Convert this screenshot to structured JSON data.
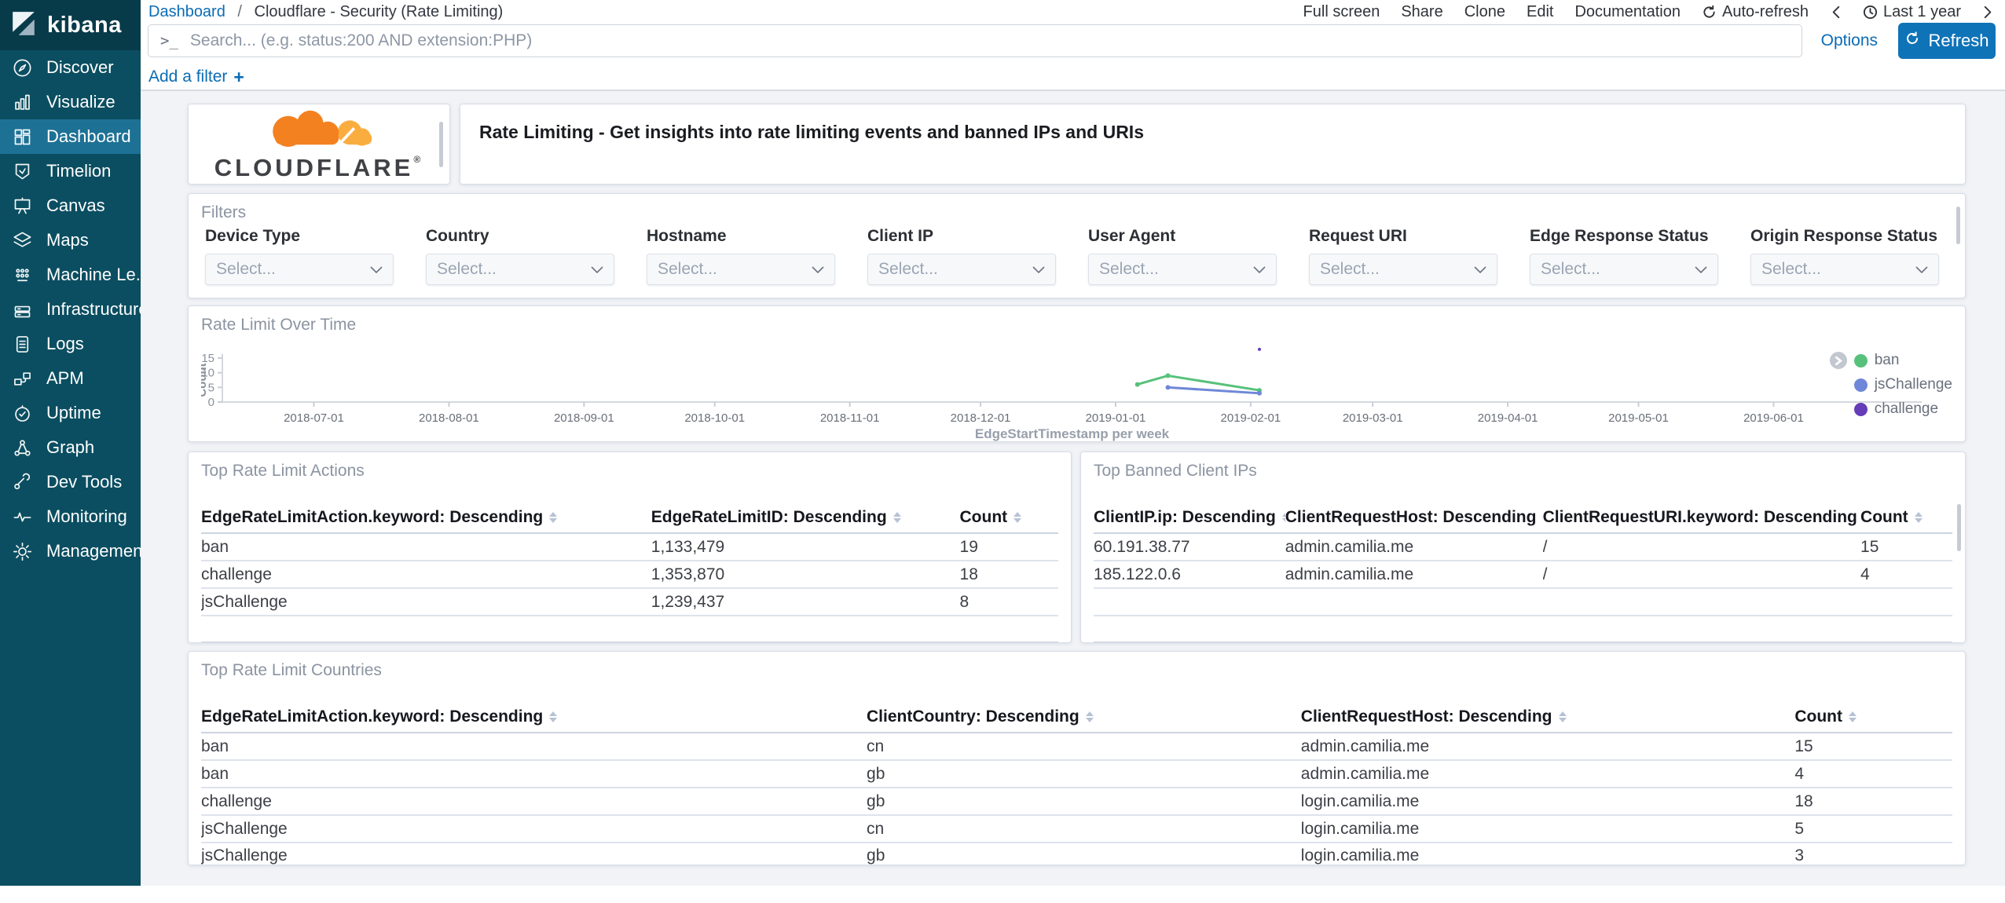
{
  "sidebar": {
    "logo_text": "kibana",
    "items": [
      {
        "id": "discover",
        "label": "Discover",
        "icon": "compass-icon",
        "active": false
      },
      {
        "id": "visualize",
        "label": "Visualize",
        "icon": "bar-chart-icon",
        "active": false
      },
      {
        "id": "dashboard",
        "label": "Dashboard",
        "icon": "dashboard-grid-icon",
        "active": true
      },
      {
        "id": "timelion",
        "label": "Timelion",
        "icon": "timelion-icon",
        "active": false
      },
      {
        "id": "canvas",
        "label": "Canvas",
        "icon": "canvas-icon",
        "active": false
      },
      {
        "id": "maps",
        "label": "Maps",
        "icon": "map-layers-icon",
        "active": false
      },
      {
        "id": "machine-learning",
        "label": "Machine Le...",
        "icon": "machine-learning-icon",
        "active": false
      },
      {
        "id": "infrastructure",
        "label": "Infrastructure",
        "icon": "infrastructure-icon",
        "active": false
      },
      {
        "id": "logs",
        "label": "Logs",
        "icon": "logs-icon",
        "active": false
      },
      {
        "id": "apm",
        "label": "APM",
        "icon": "apm-icon",
        "active": false
      },
      {
        "id": "uptime",
        "label": "Uptime",
        "icon": "uptime-clock-icon",
        "active": false
      },
      {
        "id": "graph",
        "label": "Graph",
        "icon": "graph-nodes-icon",
        "active": false
      },
      {
        "id": "dev-tools",
        "label": "Dev Tools",
        "icon": "wrench-icon",
        "active": false
      },
      {
        "id": "monitoring",
        "label": "Monitoring",
        "icon": "heartbeat-icon",
        "active": false
      },
      {
        "id": "management",
        "label": "Management",
        "icon": "gear-icon",
        "active": false
      }
    ]
  },
  "topbar": {
    "breadcrumb_root": "Dashboard",
    "breadcrumb_separator": "/",
    "breadcrumb_current": "Cloudflare - Security (Rate Limiting)",
    "menu": [
      "Full screen",
      "Share",
      "Clone",
      "Edit",
      "Documentation"
    ],
    "auto_refresh_label": "Auto-refresh",
    "time_range": "Last 1 year"
  },
  "search": {
    "terminal_glyph": ">_",
    "placeholder": "Search... (e.g. status:200 AND extension:PHP)",
    "options_label": "Options",
    "refresh_label": "Refresh"
  },
  "filter_bar": {
    "add_filter_label": "Add a filter"
  },
  "branding": {
    "wordmark": "CLOUDFLARE",
    "registered_mark": "®",
    "cloud_orange": "#f48120",
    "cloud_light_orange": "#faad3f"
  },
  "description_panel": {
    "text": "Rate Limiting - Get insights into rate limiting events and banned IPs and URIs"
  },
  "filters_panel": {
    "title": "Filters",
    "select_placeholder": "Select...",
    "fields": [
      "Device Type",
      "Country",
      "Hostname",
      "Client IP",
      "User Agent",
      "Request URI",
      "Edge Response Status",
      "Origin Response Status"
    ]
  },
  "chart_panel": {
    "title": "Rate Limit Over Time"
  },
  "chart_data": {
    "type": "line",
    "title": "Rate Limit Over Time",
    "xlabel": "EdgeStartTimestamp per week",
    "ylabel": "Count",
    "ylim": [
      0,
      20
    ],
    "yticks": [
      0,
      5,
      10,
      15
    ],
    "xticks": [
      "2018-07-01",
      "2018-08-01",
      "2018-09-01",
      "2018-10-01",
      "2018-11-01",
      "2018-12-01",
      "2019-01-01",
      "2019-02-01",
      "2019-03-01",
      "2019-04-01",
      "2019-05-01",
      "2019-06-01"
    ],
    "x_domain": [
      "2018-06-10",
      "2019-07-05"
    ],
    "grid": false,
    "legend_position": "right",
    "series": [
      {
        "name": "ban",
        "color": "#57c17b",
        "points": [
          [
            "2019-01-06",
            6
          ],
          [
            "2019-01-13",
            9
          ],
          [
            "2019-02-03",
            4
          ]
        ]
      },
      {
        "name": "jsChallenge",
        "color": "#6f87d8",
        "points": [
          [
            "2019-01-13",
            5
          ],
          [
            "2019-02-03",
            3
          ]
        ]
      },
      {
        "name": "challenge",
        "color": "#663db8",
        "points": [
          [
            "2019-02-03",
            18
          ]
        ]
      }
    ]
  },
  "tables": [
    {
      "id": "actions",
      "title": "Top Rate Limit Actions",
      "columns": [
        "EdgeRateLimitAction.keyword: Descending",
        "EdgeRateLimitID: Descending",
        "Count"
      ],
      "rows": [
        [
          "ban",
          "1,133,479",
          "19"
        ],
        [
          "challenge",
          "1,353,870",
          "18"
        ],
        [
          "jsChallenge",
          "1,239,437",
          "8"
        ]
      ],
      "empty_rows": 1
    },
    {
      "id": "banned-ips",
      "title": "Top Banned Client IPs",
      "columns": [
        "ClientIP.ip: Descending",
        "ClientRequestHost: Descending",
        "ClientRequestURI.keyword: Descending",
        "Count"
      ],
      "rows": [
        [
          "60.191.38.77",
          "admin.camilia.me",
          "/",
          "15"
        ],
        [
          "185.122.0.6",
          "admin.camilia.me",
          "/",
          "4"
        ]
      ],
      "empty_rows": 2
    },
    {
      "id": "countries",
      "title": "Top Rate Limit Countries",
      "columns": [
        "EdgeRateLimitAction.keyword: Descending",
        "ClientCountry: Descending",
        "ClientRequestHost: Descending",
        "Count"
      ],
      "rows": [
        [
          "ban",
          "cn",
          "admin.camilia.me",
          "15"
        ],
        [
          "ban",
          "gb",
          "admin.camilia.me",
          "4"
        ],
        [
          "challenge",
          "gb",
          "login.camilia.me",
          "18"
        ],
        [
          "jsChallenge",
          "cn",
          "login.camilia.me",
          "5"
        ],
        [
          "jsChallenge",
          "gb",
          "login.camilia.me",
          "3"
        ]
      ],
      "empty_rows": 0
    }
  ],
  "colors": {
    "accent_blue": "#0b6cb5",
    "refresh_button": "#0f73b8",
    "sidebar_bg": "#0b4e61",
    "sidebar_selected": "#1d7195"
  }
}
